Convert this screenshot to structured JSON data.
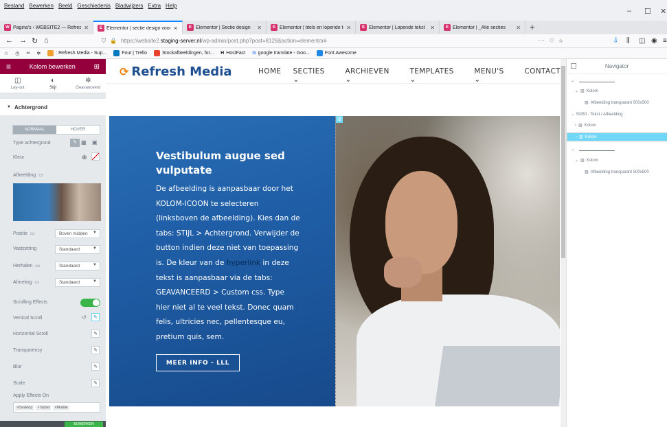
{
  "menubar": {
    "items": [
      "Bestand",
      "Bewerken",
      "Beeld",
      "Geschiedenis",
      "Bladwijzers",
      "Extra",
      "Help"
    ]
  },
  "tabs": [
    {
      "title": "Pagina's ‹ WEBSITE2 — Refresh",
      "active": false
    },
    {
      "title": "Elementor | sectie design voor",
      "active": true
    },
    {
      "title": "Elementor | Sectie design",
      "active": false
    },
    {
      "title": "Elementor | titels en lopende te",
      "active": false
    },
    {
      "title": "Elementor | Lopende tekst",
      "active": false
    },
    {
      "title": "Elementor | _Alle secties",
      "active": false
    }
  ],
  "url": {
    "prefix": "https://website2.",
    "host": "staging-server.nl",
    "path": "/wp-admin/post.php?post=8128&action=elementor#"
  },
  "bookmarks": [
    {
      "label": ": Refresh Media - Sup...",
      "color": "#f0a030"
    },
    {
      "label": "Fout | Trello",
      "color": "#0079bf"
    },
    {
      "label": "Stockafbeeldingen, fot...",
      "color": "#e8412c"
    },
    {
      "label": "HostFact",
      "color": "#333333"
    },
    {
      "label": "google translate - Goo...",
      "color": "#4285f4"
    },
    {
      "label": "Font Awesome",
      "color": "#228ae6"
    }
  ],
  "panel": {
    "title": "Kolom bewerken",
    "tabs": [
      "Lay-out",
      "Stijl",
      "Geavanceerd"
    ],
    "section": "Achtergrond",
    "state_tabs": [
      "NORMAAL",
      "HOVER"
    ],
    "type_label": "Type achtergrond",
    "color_label": "Kleur",
    "image_label": "Afbeelding",
    "position_label": "Positie",
    "position_value": "Boven midden",
    "attach_label": "Vastzetting",
    "attach_value": "Standaard",
    "repeat_label": "Herhalen",
    "repeat_value": "Standaard",
    "size_label": "Afmeting",
    "size_value": "Standaard",
    "scroll_label": "Scrolling Effects",
    "vscroll_label": "Vertical Scroll",
    "hscroll_label": "Horizontal Scroll",
    "transp_label": "Transparency",
    "blur_label": "Blur",
    "scale_label": "Scale",
    "apply_label": "Apply Effects On",
    "chips": [
      "Desktop",
      "Tablet",
      "Mobile"
    ],
    "update_label": "BIJWERKEN"
  },
  "site": {
    "logo": "Refresh Media",
    "nav": [
      "HOME",
      "SECTIES ⌄",
      "ARCHIEVEN ⌄",
      "TEMPLATES ⌄",
      "MENU'S ⌄",
      "CONTACT"
    ]
  },
  "hero": {
    "title": "Vestibulum augue sed vulputate",
    "body_1": "De afbeelding is aanpasbaar door het KOLOM-ICOON te selecteren (linksboven de afbeelding). Kies dan de tabs: STIJL > Achtergrond. Verwijder de button indien deze niet van toepassing is. De kleur van de ",
    "link": "hyperlink",
    "body_2": " in deze tekst is aanpasbaar via de tabs: GEAVANCEERD > Custom css. Type hier niet al te veel tekst. Donec quam felis, ultricies nec, pellentesque eu, pretium quis, sem.",
    "button": "MEER INFO - LLL"
  },
  "navigator": {
    "title": "Navigator",
    "rows": [
      {
        "label": "",
        "type": "line"
      },
      {
        "label": "Kolom",
        "type": "col"
      },
      {
        "label": "Afbeelding transparant 500x500",
        "type": "img"
      },
      {
        "label": "50/50 - Tekst / Afbeelding",
        "type": "sec"
      },
      {
        "label": "Kolom",
        "type": "col"
      },
      {
        "label": "Kolom",
        "type": "colsel"
      },
      {
        "label": "",
        "type": "line"
      },
      {
        "label": "Kolom",
        "type": "col"
      },
      {
        "label": "Afbeelding transparant 500x500",
        "type": "img"
      }
    ]
  },
  "colors": {
    "panel_header": "#93003c",
    "hero_blue": "#1f5ea6",
    "selected": "#71d7f7",
    "toggle_on": "#39b54a"
  }
}
